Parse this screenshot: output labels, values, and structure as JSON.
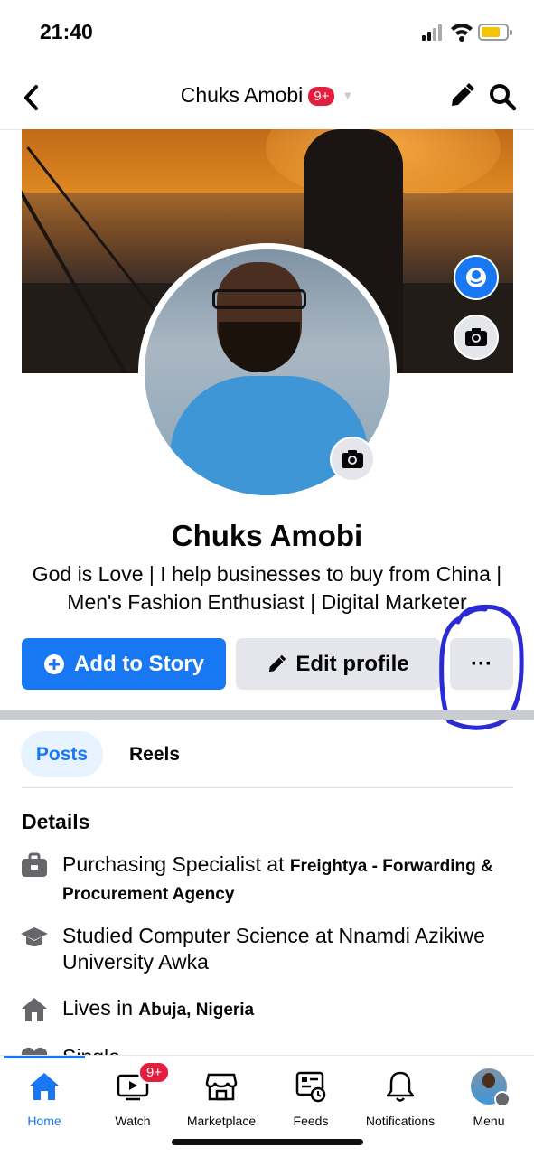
{
  "status_bar": {
    "time": "21:40"
  },
  "header": {
    "title": "Chuks Amobi",
    "notification_badge": "9+"
  },
  "profile": {
    "name": "Chuks Amobi",
    "bio_line1": "God is Love | I help businesses to buy from China |",
    "bio_line2": "Men's Fashion Enthusiast | Digital Marketer"
  },
  "actions": {
    "add_story": "Add to Story",
    "edit_profile": "Edit profile",
    "more": "···"
  },
  "tabs": [
    {
      "label": "Posts",
      "active": true
    },
    {
      "label": "Reels",
      "active": false
    }
  ],
  "details": {
    "title": "Details",
    "items": [
      {
        "icon": "briefcase-icon",
        "prefix": "Purchasing Specialist at ",
        "bold": "Freightya - Forwarding & Procurement Agency"
      },
      {
        "icon": "graduation-cap-icon",
        "prefix": "Studied Computer Science at Nnamdi Azikiwe University Awka",
        "bold": ""
      },
      {
        "icon": "house-icon",
        "prefix": "Lives in ",
        "bold": "Abuja, Nigeria"
      },
      {
        "icon": "heart-icon",
        "prefix": "Single",
        "bold": ""
      }
    ]
  },
  "bottom_nav": [
    {
      "label": "Home",
      "icon": "home-icon",
      "active": true
    },
    {
      "label": "Watch",
      "icon": "watch-icon",
      "badge": "9+"
    },
    {
      "label": "Marketplace",
      "icon": "marketplace-icon"
    },
    {
      "label": "Feeds",
      "icon": "feeds-icon"
    },
    {
      "label": "Notifications",
      "icon": "bell-icon"
    },
    {
      "label": "Menu",
      "icon": "menu-avatar-icon"
    }
  ],
  "colors": {
    "brand": "#1877f2",
    "badge": "#e41e3f",
    "annotation": "#2b2bd6"
  }
}
